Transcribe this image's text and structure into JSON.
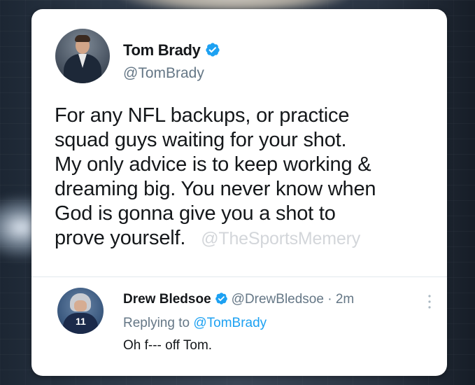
{
  "main_tweet": {
    "author_name": "Tom Brady",
    "author_handle": "@TomBrady",
    "verified": true,
    "text_lines": [
      "For any NFL backups, or practice",
      "squad guys waiting for your shot.",
      "My only advice is to keep working &",
      "dreaming big. You never know when",
      "God is gonna give you a shot to",
      "prove yourself."
    ],
    "watermark": "@TheSportsMemery"
  },
  "reply_tweet": {
    "author_name": "Drew Bledsoe",
    "verified": true,
    "author_handle": "@DrewBledsoe",
    "separator": "·",
    "time": "2m",
    "replying_prefix": "Replying to",
    "replying_to": "@TomBrady",
    "text": "Oh f--- off Tom.",
    "avatar_jersey_number": "11"
  },
  "colors": {
    "verified": "#1da1f2",
    "link": "#1da1f2",
    "secondary_text": "#657786",
    "primary_text": "#14171a"
  },
  "icons": {
    "verified": "verified-badge-icon",
    "more": "more-vertical-icon"
  }
}
